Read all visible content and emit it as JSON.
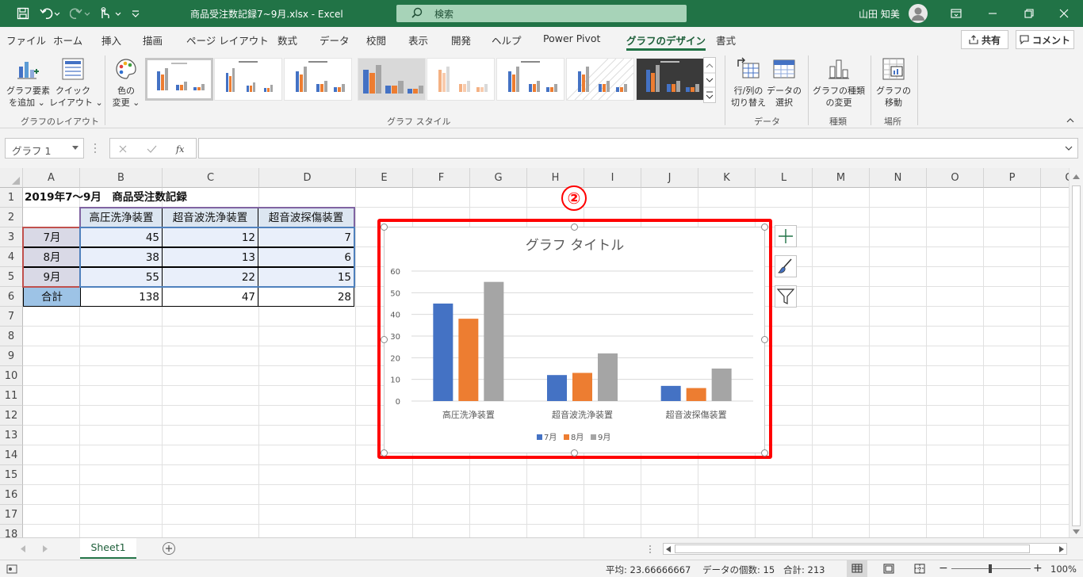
{
  "window": {
    "filename": "商品受注数記録7~9月.xlsx  -  Excel",
    "search_placeholder": "検索",
    "user_name": "山田 知美"
  },
  "tabs": [
    "ファイル",
    "ホーム",
    "挿入",
    "描画",
    "ページ レイアウト",
    "数式",
    "データ",
    "校閲",
    "表示",
    "開発",
    "ヘルプ",
    "Power Pivot",
    "グラフのデザイン",
    "書式"
  ],
  "active_tab": "グラフのデザイン",
  "tab_buttons": {
    "share": "共有",
    "comment": "コメント"
  },
  "ribbon": {
    "add_element": [
      "グラフ要素",
      "を追加 ⌄"
    ],
    "quick_layout": [
      "クイック",
      "レイアウト ⌄"
    ],
    "change_color": [
      "色の",
      "変更 ⌄"
    ],
    "switch_rowcol": [
      "行/列の",
      "切り替え"
    ],
    "select_data": [
      "データの",
      "選択"
    ],
    "change_type": [
      "グラフの種類",
      "の変更"
    ],
    "move_chart": [
      "グラフの",
      "移動"
    ],
    "groups": {
      "layout": "グラフのレイアウト",
      "styles": "グラフ スタイル",
      "data": "データ",
      "type": "種類",
      "location": "場所"
    }
  },
  "namebox": "グラフ 1",
  "columns": [
    "A",
    "B",
    "C",
    "D",
    "E",
    "F",
    "G",
    "H",
    "I",
    "J",
    "K",
    "L",
    "M",
    "N",
    "O",
    "P",
    "Q"
  ],
  "rows": [
    "1",
    "2",
    "3",
    "4",
    "5",
    "6",
    "7",
    "8",
    "9",
    "10",
    "11",
    "12",
    "13",
    "14",
    "15",
    "16",
    "17",
    "18"
  ],
  "sheet": {
    "title": "2019年7～9月　商品受注数記録",
    "headers": [
      "高圧洗浄装置",
      "超音波洗浄装置",
      "超音波探傷装置"
    ],
    "row_labels": [
      "7月",
      "8月",
      "9月",
      "合計"
    ],
    "values": [
      [
        "45",
        "12",
        "7"
      ],
      [
        "38",
        "13",
        "6"
      ],
      [
        "55",
        "22",
        "15"
      ],
      [
        "138",
        "47",
        "28"
      ]
    ]
  },
  "chart_data": {
    "type": "bar",
    "title": "グラフ タイトル",
    "categories": [
      "高圧洗浄装置",
      "超音波洗浄装置",
      "超音波探傷装置"
    ],
    "series": [
      {
        "name": "7月",
        "values": [
          45,
          12,
          7
        ],
        "color": "#4472c4"
      },
      {
        "name": "8月",
        "values": [
          38,
          13,
          6
        ],
        "color": "#ed7d31"
      },
      {
        "name": "9月",
        "values": [
          55,
          22,
          15
        ],
        "color": "#a5a5a5"
      }
    ],
    "yticks": [
      "0",
      "10",
      "20",
      "30",
      "40",
      "50",
      "60"
    ],
    "ylim": [
      0,
      60
    ],
    "grid": true,
    "legend": "bottom"
  },
  "annotation_badge": "②",
  "sheet_tab": "Sheet1",
  "status": {
    "average": "平均: 23.66666667",
    "count": "データの個数: 15",
    "sum": "合計: 213",
    "zoom": "100%"
  },
  "colors": {
    "excel_green": "#217346",
    "highlight_red": "#ff0000"
  }
}
